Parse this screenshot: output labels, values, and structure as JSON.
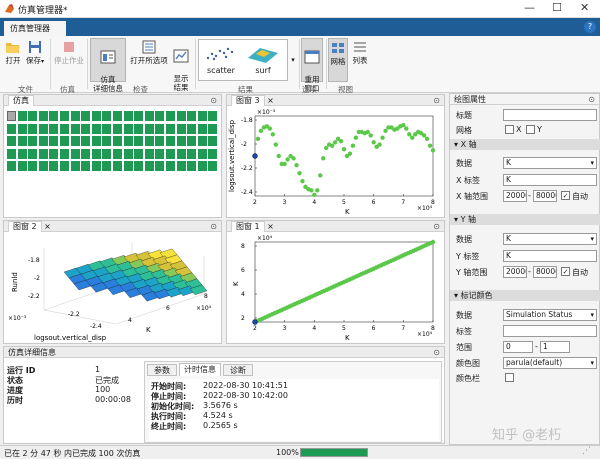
{
  "window": {
    "title": "仿真管理器*",
    "controls": [
      "—",
      "☐",
      "✕"
    ]
  },
  "tabstrip": {
    "tab": "仿真管理器"
  },
  "ribbon": {
    "open": "打开",
    "save": "保存",
    "stop": "停止作业",
    "details": "仿真\n详细信息",
    "open_all": "打开所选项",
    "show_results": "显示\n结果",
    "gallery": [
      "scatter",
      "surf"
    ],
    "reuse": "重用\n窗口",
    "grid": "网格",
    "list": "列表",
    "groups": [
      "文件",
      "仿真",
      "检查",
      "结果",
      "选项",
      "视图"
    ]
  },
  "sim_panel": {
    "title": "仿真"
  },
  "fig3": {
    "tab": "图窗 3",
    "ylabel": "logsout.vertical_disp",
    "xlabel": "K",
    "xexp": "×10⁴",
    "yexp": "×10⁻³",
    "xticks": [
      "2",
      "3",
      "4",
      "5",
      "6",
      "7",
      "8"
    ],
    "yticks": [
      "-1.8",
      "-2",
      "-2.2",
      "-2.4"
    ]
  },
  "fig2": {
    "tab": "图窗 2",
    "zlabel": "Runld",
    "xlabel": "K",
    "ylabel": "logsout.vertical_disp",
    "xexp": "×10⁴",
    "yexp": "×10⁻³",
    "zticks": [
      "-1.8",
      "-2",
      "-2.2"
    ],
    "yticks": [
      "-2.2",
      "-2.4"
    ],
    "xticks": [
      "4",
      "6",
      "8"
    ]
  },
  "fig1": {
    "tab": "图窗 1",
    "ylabel": "K",
    "xlabel": "K",
    "xexp": "×10⁴",
    "yexp": "×10⁴",
    "xticks": [
      "2",
      "3",
      "4",
      "5",
      "6",
      "7",
      "8"
    ],
    "yticks": [
      "8",
      "6",
      "4",
      "2"
    ]
  },
  "details": {
    "title": "仿真详细信息",
    "left": [
      {
        "k": "运行 ID",
        "v": "1"
      },
      {
        "k": "状态",
        "v": "已完成"
      },
      {
        "k": "进度",
        "v": "100"
      },
      {
        "k": "历时",
        "v": "00:00:08"
      }
    ],
    "tabs": [
      "参数",
      "计时信息",
      "诊断"
    ],
    "timing": [
      {
        "k": "开始时间:",
        "v": "2022-08-30 10:41:51"
      },
      {
        "k": "停止时间:",
        "v": "2022-08-30 10:42:00"
      },
      {
        "k": "初始化时间:",
        "v": "3.5676 s"
      },
      {
        "k": "执行时间:",
        "v": "4.524 s"
      },
      {
        "k": "终止时间:",
        "v": "0.2565 s"
      }
    ]
  },
  "props": {
    "title": "绘图属性",
    "title_label": "标题",
    "grid_label": "网格",
    "grid_x": "X",
    "grid_y": "Y",
    "xsec": "X 轴",
    "xdata_label": "数据",
    "xdata": "K",
    "xlabel_label": "X 标签",
    "xlabel": "K",
    "xrange_label": "X 轴范围",
    "xmin": "20000",
    "xmax": "80000",
    "auto": "自动",
    "ysec": "Y 轴",
    "ydata_label": "数据",
    "ydata": "K",
    "ylabel_label": "Y 标签",
    "ylabel": "K",
    "yrange_label": "Y 轴范围",
    "ymin": "20000",
    "ymax": "80000",
    "csec": "标记颜色",
    "cdata_label": "数据",
    "cdata": "Simulation Status",
    "clabel_label": "标签",
    "crange_label": "范围",
    "cmin": "0",
    "cmax": "1",
    "cmap_label": "颜色图",
    "cmap": "parula(default)",
    "cbar_label": "颜色栏"
  },
  "status": {
    "text": "已在 2 分 47 秒 内已完成 100 次仿真",
    "pct": "100%",
    "progress": 1.0
  },
  "watermark": "知乎 @老朽",
  "colors": {
    "accent": "#1f5d96",
    "point": "#5bc84a",
    "cell": "#1f9a55"
  },
  "chart_data": [
    {
      "type": "scatter",
      "title": "",
      "xlabel": "K",
      "ylabel": "logsout.vertical_disp",
      "xlim": [
        20000,
        80000
      ],
      "ylim": [
        -0.0024,
        -0.0017
      ],
      "x": [
        20000,
        21000,
        22000,
        23000,
        24000,
        25000,
        26000,
        27000,
        28000,
        29000,
        30000,
        31000,
        32000,
        33000,
        34000,
        35000,
        36000,
        37000,
        38000,
        39000,
        40000,
        41000,
        42000,
        43000,
        44000,
        45000,
        46000,
        47000,
        48000,
        49000,
        50000,
        51000,
        52000,
        53000,
        54000,
        55000,
        56000,
        57000,
        58000,
        59000,
        60000,
        61000,
        62000,
        63000,
        64000,
        65000,
        66000,
        67000,
        68000,
        69000,
        70000,
        71000,
        72000,
        73000,
        74000,
        75000,
        76000,
        77000,
        78000,
        79000,
        80000
      ],
      "y": [
        -0.00205,
        -0.0019,
        -0.00183,
        -0.0018,
        -0.00179,
        -0.00181,
        -0.00186,
        -0.00195,
        -0.00205,
        -0.00212,
        -0.00212,
        -0.00208,
        -0.00205,
        -0.00207,
        -0.00213,
        -0.0022,
        -0.00227,
        -0.00232,
        -0.00234,
        -0.00235,
        -0.00239,
        -0.00235,
        -0.00222,
        -0.00207,
        -0.00198,
        -0.00195,
        -0.00196,
        -0.00193,
        -0.0019,
        -0.00192,
        -0.00199,
        -0.00205,
        -0.00203,
        -0.00196,
        -0.00189,
        -0.00184,
        -0.00184,
        -0.00185,
        -0.00184,
        -0.00187,
        -0.00193,
        -0.00197,
        -0.00195,
        -0.00189,
        -0.00183,
        -0.0018,
        -0.0018,
        -0.00182,
        -0.00181,
        -0.00179,
        -0.00178,
        -0.00181,
        -0.00186,
        -0.00189,
        -0.00186,
        -0.00184,
        -0.00185,
        -0.00187,
        -0.0019,
        -0.00196,
        -0.002
      ]
    },
    {
      "type": "scatter",
      "title": "",
      "xlabel": "K",
      "ylabel": "K",
      "xlim": [
        20000,
        80000
      ],
      "ylim": [
        20000,
        80000
      ],
      "x": [
        20000,
        25000,
        30000,
        35000,
        40000,
        45000,
        50000,
        55000,
        60000,
        65000,
        70000,
        75000,
        80000
      ],
      "y": [
        20000,
        25000,
        30000,
        35000,
        40000,
        45000,
        50000,
        55000,
        60000,
        65000,
        70000,
        75000,
        80000
      ]
    }
  ]
}
